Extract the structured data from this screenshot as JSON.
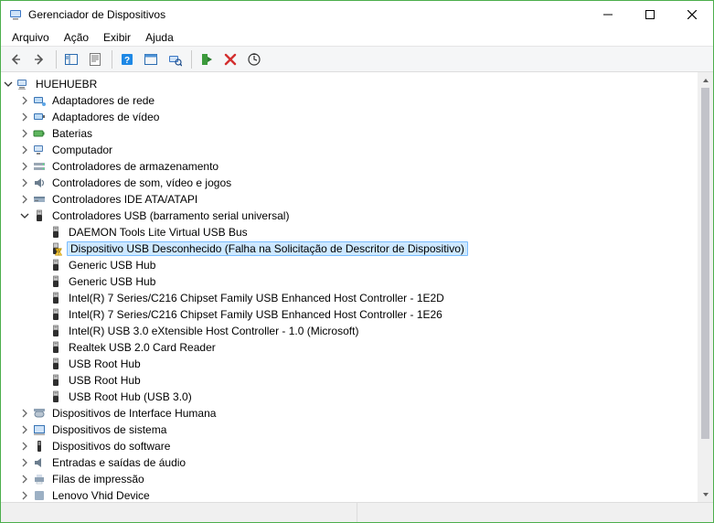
{
  "window": {
    "title": "Gerenciador de Dispositivos"
  },
  "menu": {
    "file": "Arquivo",
    "action": "Ação",
    "view": "Exibir",
    "help": "Ajuda"
  },
  "root": {
    "name": "HUEHUEBR"
  },
  "categories": {
    "netAdapters": "Adaptadores de rede",
    "videoAdapters": "Adaptadores de vídeo",
    "batteries": "Baterias",
    "computer": "Computador",
    "storageCtrl": "Controladores de armazenamento",
    "soundCtrl": "Controladores de som, vídeo e jogos",
    "ideCtrl": "Controladores IDE ATA/ATAPI",
    "usbCtrl": "Controladores USB (barramento serial universal)",
    "hid": "Dispositivos de Interface Humana",
    "systemDevices": "Dispositivos de sistema",
    "softwareDevices": "Dispositivos do software",
    "audioIO": "Entradas e saídas de áudio",
    "printQueues": "Filas de impressão",
    "lenovoVhid": "Lenovo Vhid Device"
  },
  "usbChildren": [
    "DAEMON Tools Lite Virtual USB Bus",
    "Dispositivo USB Desconhecido (Falha na Solicitação de Descritor de Dispositivo)",
    "Generic USB Hub",
    "Generic USB Hub",
    "Intel(R) 7 Series/C216 Chipset Family USB Enhanced Host Controller - 1E2D",
    "Intel(R) 7 Series/C216 Chipset Family USB Enhanced Host Controller - 1E26",
    "Intel(R) USB 3.0 eXtensible Host Controller - 1.0 (Microsoft)",
    "Realtek USB 2.0 Card Reader",
    "USB Root Hub",
    "USB Root Hub",
    "USB Root Hub (USB 3.0)"
  ],
  "selectedUsbIndex": 1,
  "warningUsbIndex": 1
}
